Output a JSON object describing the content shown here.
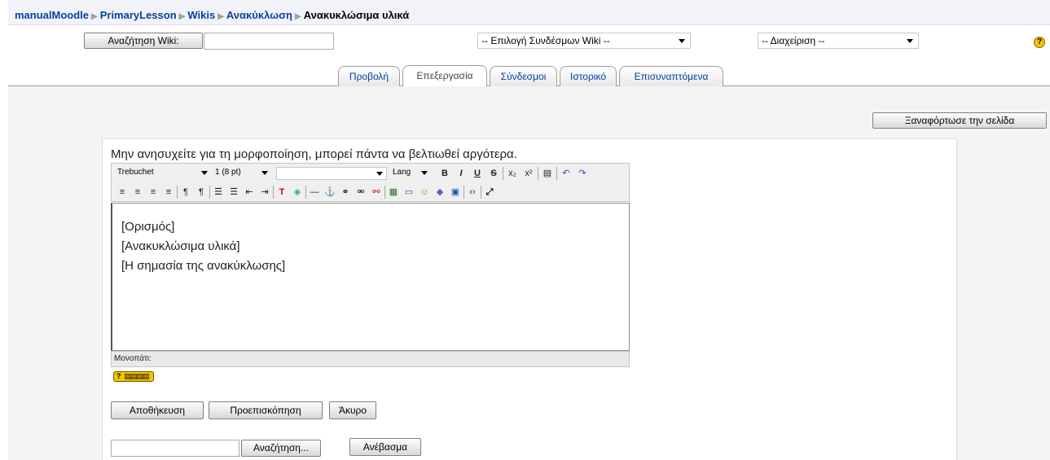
{
  "breadcrumb": {
    "items": [
      "manualMoodle",
      "PrimaryLesson",
      "Wikis",
      "Ανακύκλωση"
    ],
    "current": "Ανακυκλώσιμα υλικά"
  },
  "wiki_bar": {
    "search_button": "Αναζήτηση Wiki:",
    "links_select": "-- Επιλογή Συνδέσμων Wiki --",
    "admin_select": "-- Διαχείριση --",
    "help_icon": "help-icon"
  },
  "tabs": [
    "Προβολή",
    "Επεξεργασία",
    "Σύνδεσμοι",
    "Ιστορικό",
    "Επισυναπτόμενα"
  ],
  "reload_button": "Ξαναφόρτωσε την σελίδα",
  "notice": "Μην ανησυχείτε για τη μορφοποίηση, μπορεί πάντα να βελτιωθεί αργότερα.",
  "toolbar": {
    "font": "Trebuchet",
    "size": "1 (8 pt)",
    "format": "",
    "lang": "Lang",
    "row1": [
      "B",
      "I",
      "U",
      "S",
      "x₂",
      "x²",
      "▤",
      "↶",
      "↷"
    ],
    "row2": [
      "≡",
      "≡",
      "≡",
      "≡",
      "¶",
      "¶",
      "☰",
      "☰",
      "⇤",
      "⇥",
      "T",
      "◈",
      "—",
      "⚓",
      "⚭",
      "⚮",
      "⚯",
      "▦",
      "▭",
      "☺",
      "◆",
      "▣",
      "‹›",
      "⤢"
    ]
  },
  "editor": {
    "lines": [
      "[Ορισμός]",
      "[Ανακυκλώσιμα υλικά]",
      "[Η σημασία της ανακύκλωσης]"
    ]
  },
  "path_label": "Μονοπάτι:",
  "buttons": {
    "save": "Αποθήκευση",
    "preview": "Προεπισκόπηση",
    "cancel": "Άκυρο",
    "browse": "Αναζήτηση...",
    "upload": "Ανέβασμα"
  },
  "colors": {
    "link": "#0a3f9e",
    "breadcrumb_bg": "#f1f3f8",
    "help_icon": "#f4c400"
  }
}
